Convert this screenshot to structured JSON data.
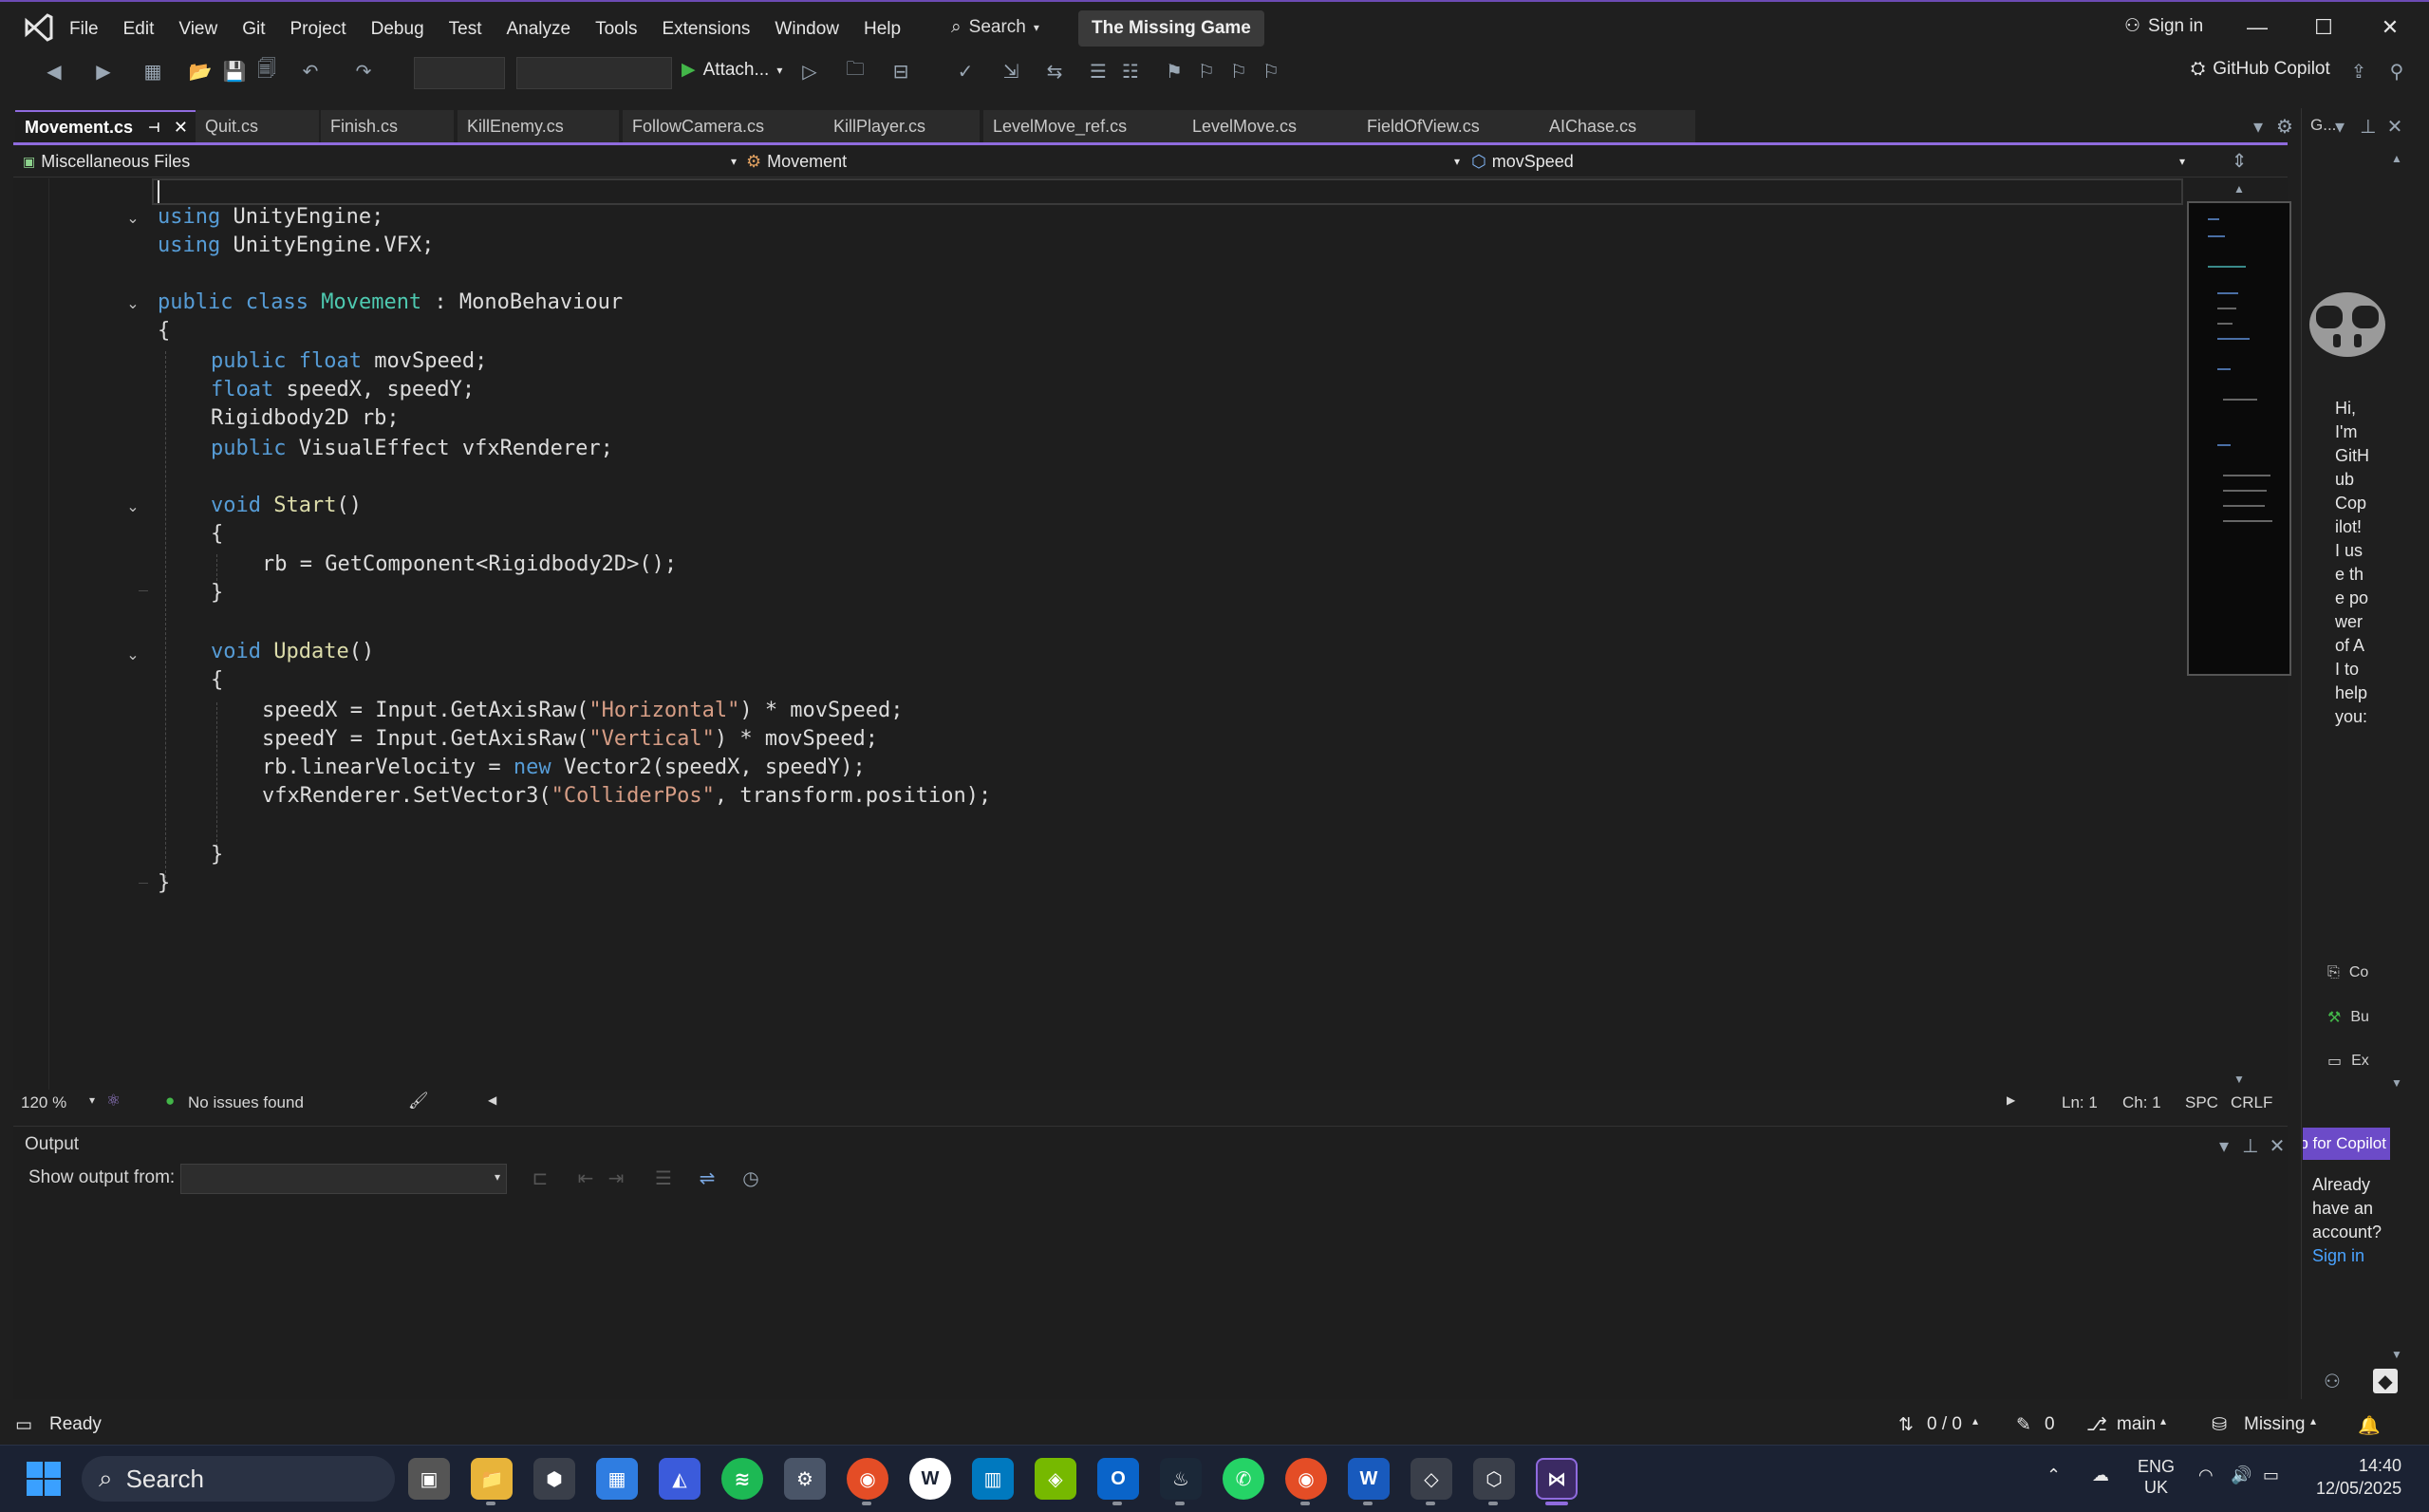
{
  "menu": {
    "items": [
      "File",
      "Edit",
      "View",
      "Git",
      "Project",
      "Debug",
      "Test",
      "Analyze",
      "Tools",
      "Extensions",
      "Window",
      "Help"
    ],
    "search_label": "Search",
    "project_title": "The Missing Game",
    "signin_label": "Sign in"
  },
  "toolbar": {
    "attach_label": "Attach...",
    "copilot_label": "GitHub Copilot"
  },
  "tabs": [
    {
      "label": "Movement.cs",
      "active": true
    },
    {
      "label": "Quit.cs"
    },
    {
      "label": "Finish.cs"
    },
    {
      "label": "KillEnemy.cs"
    },
    {
      "label": "FollowCamera.cs"
    },
    {
      "label": "KillPlayer.cs"
    },
    {
      "label": "LevelMove_ref.cs"
    },
    {
      "label": "LevelMove.cs"
    },
    {
      "label": "FieldOfView.cs"
    },
    {
      "label": "AIChase.cs"
    }
  ],
  "navbar": {
    "project": "Miscellaneous Files",
    "type": "Movement",
    "member": "movSpeed"
  },
  "code": {
    "l1": "using UnityEngine;",
    "l2": "using UnityEngine.VFX;",
    "l4": "public class Movement : MonoBehaviour",
    "l5": "{",
    "l6": "public float movSpeed;",
    "l7": "float speedX, speedY;",
    "l8": "Rigidbody2D rb;",
    "l9": "public VisualEffect vfxRenderer;",
    "l11": "void Start()",
    "l12": "{",
    "l13": "rb = GetComponent<Rigidbody2D>();",
    "l14": "}",
    "l16": "void Update()",
    "l17": "{",
    "l18": "speedX = Input.GetAxisRaw(\"Horizontal\") * movSpeed;",
    "l19": "speedY = Input.GetAxisRaw(\"Vertical\") * movSpeed;",
    "l20": "rb.linearVelocity = new Vector2(speedX, speedY);",
    "l21": "vfxRenderer.SetVector3(\"ColliderPos\", transform.position);",
    "l23": "}",
    "l24": "}"
  },
  "editor_status": {
    "zoom": "120 %",
    "issues": "No issues found",
    "ln": "Ln: 1",
    "ch": "Ch: 1",
    "spc": "SPC",
    "eol": "CRLF"
  },
  "output": {
    "title": "Output",
    "show_from_label": "Show output from:"
  },
  "copilot_panel": {
    "tab_label": "G...",
    "greeting": "Hi, I'm GitHub Copilot! I use the power of AI to help you:",
    "cmd1": "Co",
    "cmd2": "Bu",
    "cmd3": "Ex",
    "signup_label": "p for Copilot",
    "account_text": "Already have an account?",
    "signin_link": "Sign in"
  },
  "statusbar": {
    "ready": "Ready",
    "changes": "0 / 0",
    "edits": "0",
    "branch": "main",
    "repo": "Missing"
  },
  "taskbar": {
    "search": "Search",
    "lang_top": "ENG",
    "lang_bottom": "UK",
    "time": "14:40",
    "date": "12/05/2025"
  },
  "colors": {
    "accent": "#8f6bde",
    "keyword": "#569cd6",
    "type": "#4ec9b0",
    "string": "#d69d85"
  }
}
